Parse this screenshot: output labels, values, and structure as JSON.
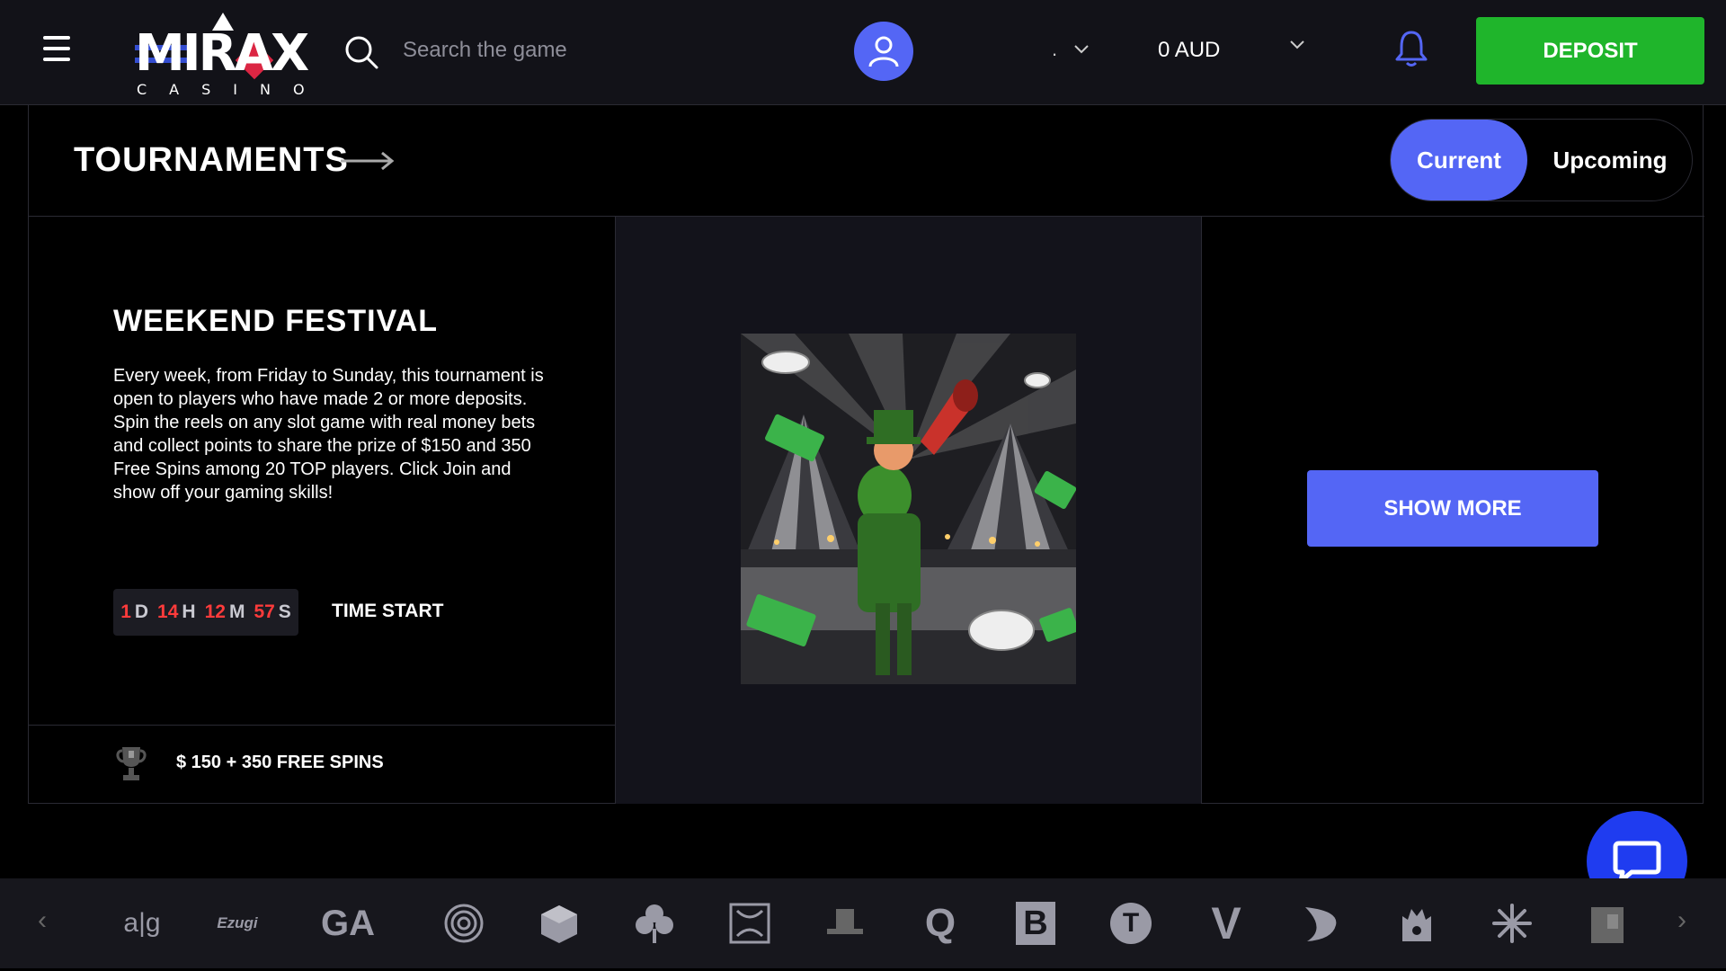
{
  "header": {
    "logo_text": "MIRAX",
    "logo_subtext": "CASINO",
    "search_placeholder": "Search the game",
    "language_value": ".",
    "balance": "0 AUD",
    "deposit_label": "DEPOSIT"
  },
  "page": {
    "title": "TOURNAMENTS",
    "tabs": [
      {
        "label": "Current",
        "active": true
      },
      {
        "label": "Upcoming",
        "active": false
      }
    ]
  },
  "tournament": {
    "name": "WEEKEND FESTIVAL",
    "description": "Every week, from Friday to Sunday, this tournament is open to players who have made 2 or more deposits. Spin the reels on any slot game with real money bets and collect points to share the prize of $150 and 350 Free Spins among 20 TOP players. Click Join and show off your gaming skills!",
    "timer": {
      "days": "1",
      "days_unit": "D",
      "hours": "14",
      "hours_unit": "H",
      "minutes": "12",
      "minutes_unit": "M",
      "seconds": "57",
      "seconds_unit": "S"
    },
    "time_label": "TIME START",
    "prize": "$ 150 + 350 FREE SPINS",
    "show_more_label": "SHOW MORE"
  },
  "providers": {
    "items": [
      {
        "icon": "aig-logo-icon",
        "text": "a|g"
      },
      {
        "icon": "ezugi-logo-icon",
        "text": "Ezugi"
      },
      {
        "icon": "gameart-logo-icon",
        "text": "GA"
      },
      {
        "icon": "spiral-provider-icon",
        "text": ""
      },
      {
        "icon": "cube-provider-icon",
        "text": ""
      },
      {
        "icon": "clover-provider-icon",
        "text": ""
      },
      {
        "icon": "pattern-provider-icon",
        "text": ""
      },
      {
        "icon": "hat-provider-icon",
        "text": ""
      },
      {
        "icon": "quickspin-logo-icon",
        "text": "Q"
      },
      {
        "icon": "b-provider-logo-icon",
        "text": "B"
      },
      {
        "icon": "t-provider-logo-icon",
        "text": "T"
      },
      {
        "icon": "v-provider-logo-icon",
        "text": "V"
      },
      {
        "icon": "wing-provider-icon",
        "text": ""
      },
      {
        "icon": "castle-provider-icon",
        "text": ""
      },
      {
        "icon": "snowflake-provider-icon",
        "text": ""
      },
      {
        "icon": "block-provider-icon",
        "text": ""
      }
    ]
  },
  "colors": {
    "accent": "#5466f5",
    "deposit": "#1fb52b",
    "timer_number": "#ff3b3b",
    "chat": "#1f3cf0"
  }
}
